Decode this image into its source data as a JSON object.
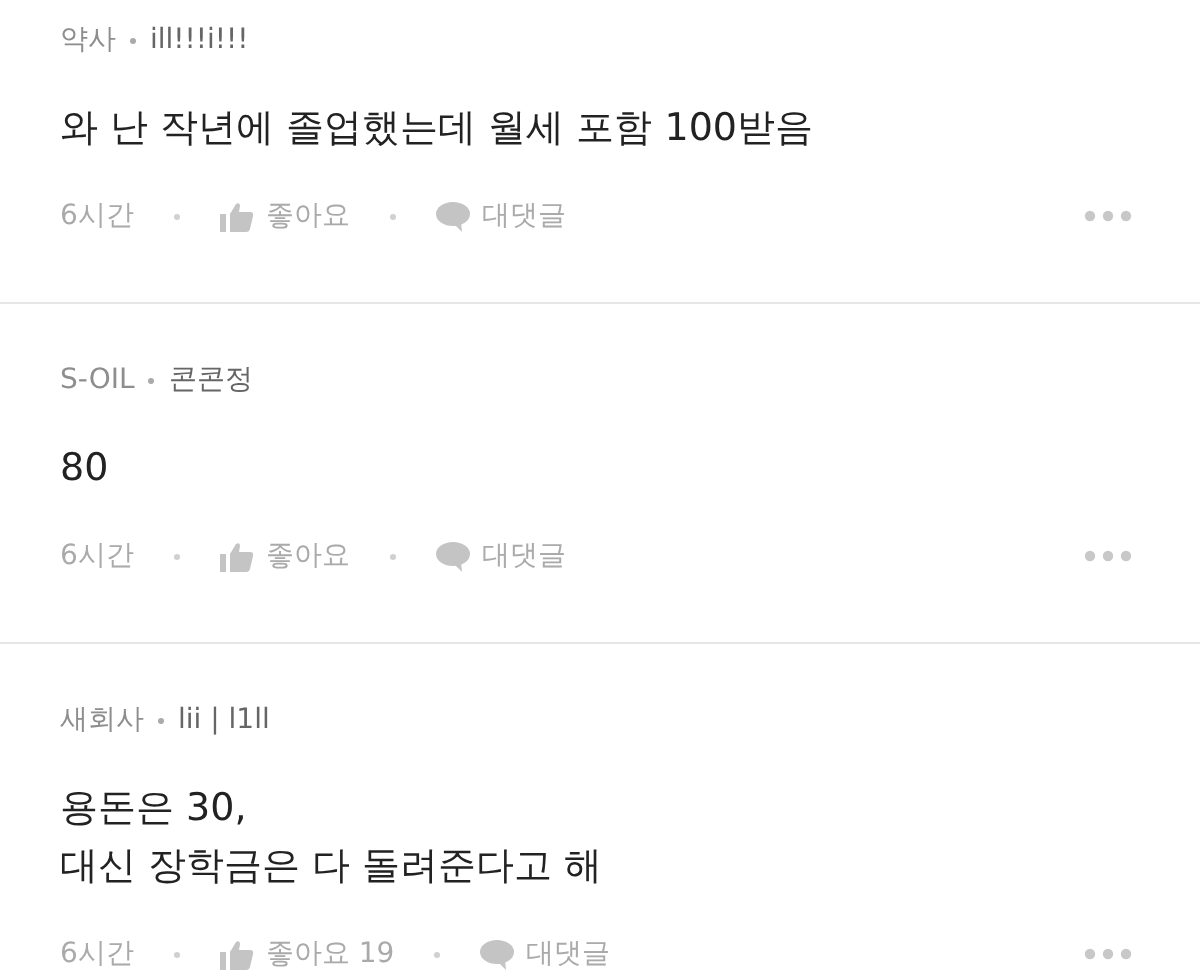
{
  "comments": [
    {
      "company": "약사",
      "nickname": "ill!!!i!!!",
      "body": "와 난 작년에 졸업했는데 월세 포함 100받음",
      "time": "6시간",
      "like": "좋아요",
      "reply": "대댓글"
    },
    {
      "company": "S-OIL",
      "nickname": "콘콘정",
      "body": "80",
      "time": "6시간",
      "like": "좋아요",
      "reply": "대댓글"
    },
    {
      "company": "새회사",
      "nickname": "lii | l1ll",
      "body": "용돈은 30,\n대신 장학금은 다 돌려준다고 해",
      "time": "6시간",
      "like": "좋아요 19",
      "reply": "대댓글"
    }
  ]
}
